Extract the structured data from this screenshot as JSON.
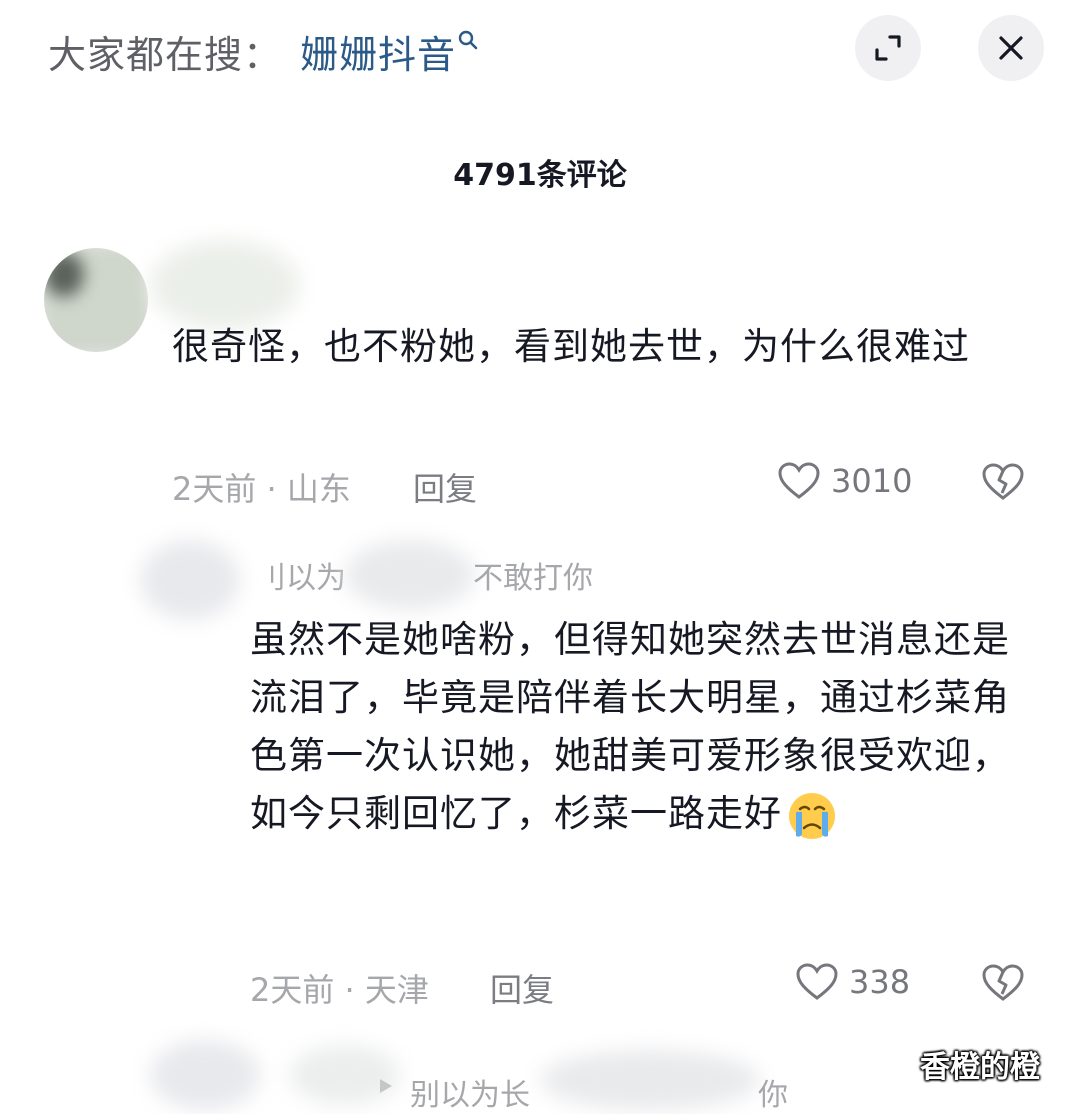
{
  "search_bar": {
    "prefix": "大家都在搜：",
    "term": "姗姗抖音",
    "icons": {
      "search": "search-icon",
      "expand": "expand-icon",
      "close": "close-icon"
    }
  },
  "header": {
    "comment_count": "4791条评论"
  },
  "comments": [
    {
      "text": "很奇怪，也不粉她，看到她去世，为什么很难过",
      "meta": "2天前 · 山东",
      "reply_label": "回复",
      "like_count": "3010"
    }
  ],
  "replies": [
    {
      "reply_to": "别以为长得漂亮我就不敢打你",
      "reply_to_visible_left": "刂以为",
      "reply_to_visible_right": "不敢打你",
      "text": "虽然不是她啥粉，但得知她突然去世消息还是流泪了，毕竟是陪伴着长大明星，通过杉菜角色第一次认识她，她甜美可爱形象很受欢迎，如今只剩回忆了，杉菜一路走好",
      "emoji": "crying-face",
      "meta": "2天前 · 天津",
      "reply_label": "回复",
      "like_count": "338"
    },
    {
      "reply_to_visible_left": "别以为长",
      "reply_to_visible_right": "你"
    }
  ],
  "watermark": "香橙的橙",
  "colors": {
    "search_term": "#2b5a88",
    "meta": "#a6a7ab",
    "text": "#161823",
    "button_bg": "#f0f0f2"
  }
}
